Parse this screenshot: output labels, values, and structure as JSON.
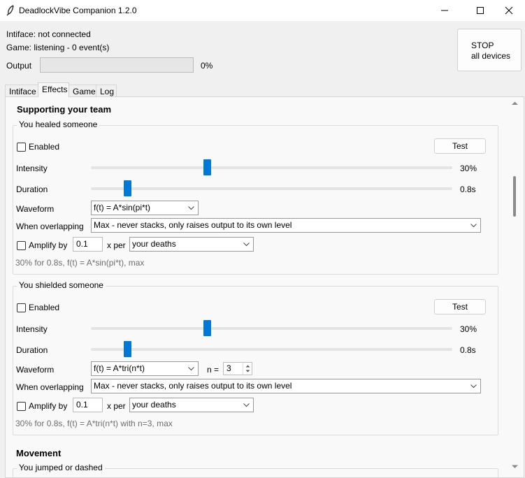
{
  "window": {
    "title": "DeadlockVibe Companion 1.2.0",
    "icon": "feather-icon"
  },
  "status": {
    "intiface": "Intiface: not connected",
    "game": "Game: listening - 0 event(s)",
    "output_label": "Output",
    "output_percent": "0%",
    "output_fraction": 0
  },
  "stop_button": {
    "line1": "STOP",
    "line2": "all devices"
  },
  "tabs": [
    {
      "label": "Intiface",
      "active": false
    },
    {
      "label": "Effects",
      "active": true
    },
    {
      "label": "Game",
      "active": false
    },
    {
      "label": "Log",
      "active": false
    }
  ],
  "sections": [
    {
      "heading": "Supporting your team",
      "groups": [
        {
          "title": "You healed someone",
          "enabled_label": "Enabled",
          "test_label": "Test",
          "intensity_label": "Intensity",
          "intensity_value": "30%",
          "intensity_fraction": 0.3,
          "duration_label": "Duration",
          "duration_value": "0.8s",
          "duration_fraction": 0.08,
          "waveform_label": "Waveform",
          "waveform_value": "f(t) = A*sin(pi*t)",
          "overlap_label": "When overlapping",
          "overlap_value": "Max - never stacks, only raises output to its own level",
          "amplify_label": "Amplify by",
          "amplify_value": "0.1",
          "per_label": "x per",
          "per_value": "your deaths",
          "summary": "30% for 0.8s, f(t) = A*sin(pi*t), max"
        },
        {
          "title": "You shielded someone",
          "enabled_label": "Enabled",
          "test_label": "Test",
          "intensity_label": "Intensity",
          "intensity_value": "30%",
          "intensity_fraction": 0.3,
          "duration_label": "Duration",
          "duration_value": "0.8s",
          "duration_fraction": 0.08,
          "waveform_label": "Waveform",
          "waveform_value": "f(t) = A*tri(n*t)",
          "n_label": "n =",
          "n_value": "3",
          "overlap_label": "When overlapping",
          "overlap_value": "Max - never stacks, only raises output to its own level",
          "amplify_label": "Amplify by",
          "amplify_value": "0.1",
          "per_label": "x per",
          "per_value": "your deaths",
          "summary": "30% for 0.8s, f(t) = A*tri(n*t) with n=3, max"
        }
      ]
    },
    {
      "heading": "Movement",
      "groups": [
        {
          "title": "You jumped or dashed"
        }
      ]
    }
  ],
  "colors": {
    "accent": "#0078d7",
    "summary_text": "#6d6d6d"
  }
}
